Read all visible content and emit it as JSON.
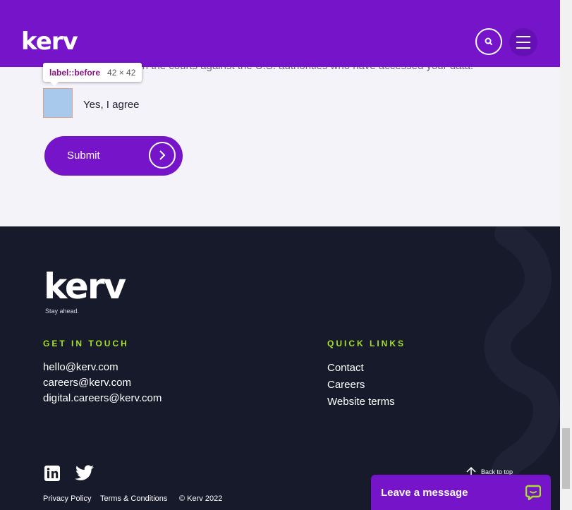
{
  "header": {
    "logo": "kerv",
    "search_icon": "search-icon",
    "menu_icon": "hamburger-icon"
  },
  "form": {
    "legal_text": "…enforceable rights in the courts against the U.S. authorities who have accessed your data.",
    "checkbox_label": "Yes, I agree",
    "submit_label": "Submit"
  },
  "devtools_tooltip": {
    "name": "label::before",
    "size": "42 × 42"
  },
  "footer": {
    "logo": "kerv",
    "tagline": "Stay ahead.",
    "get_in_touch": {
      "heading": "GET IN TOUCH",
      "emails": [
        "hello@kerv.com",
        "careers@kerv.com",
        "digital.careers@kerv.com"
      ]
    },
    "quick_links": {
      "heading": "QUICK LINKS",
      "links": [
        "Contact",
        "Careers",
        "Website terms"
      ]
    },
    "social": [
      "linkedin-icon",
      "twitter-icon"
    ],
    "legal": {
      "privacy": "Privacy Policy",
      "terms": "Terms & Conditions",
      "copyright": "© Kerv 2022"
    },
    "back_to_top": "Back to top"
  },
  "chat": {
    "label": "Leave a message",
    "icon": "chat-bubble-icon"
  },
  "colors": {
    "brand_purple": "#7514c9",
    "footer_bg": "#171a2b",
    "accent_green": "#a8e02a"
  }
}
